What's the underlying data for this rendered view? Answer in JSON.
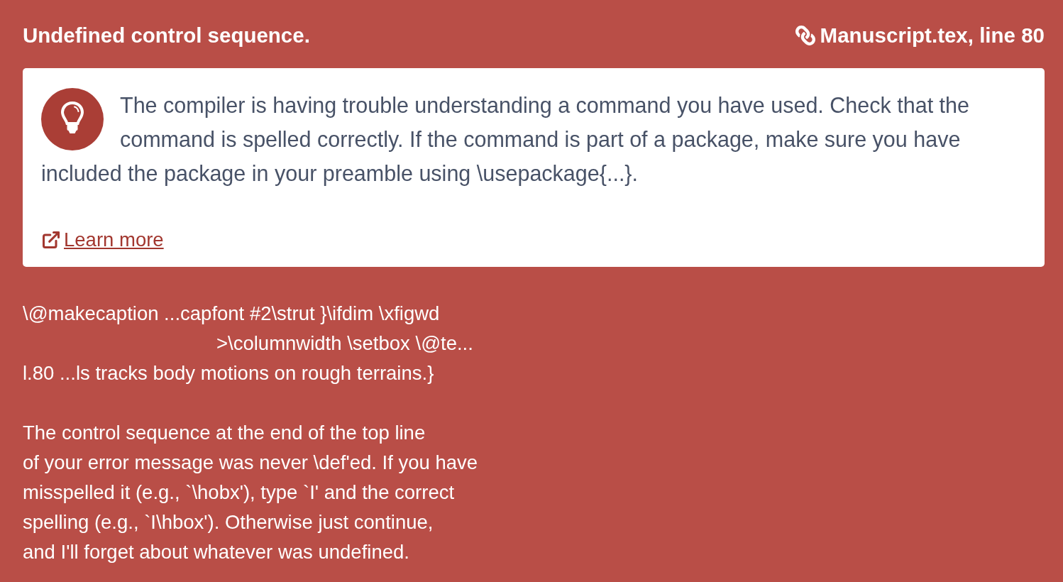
{
  "header": {
    "title": "Undefined control sequence.",
    "location": "Manuscript.tex, line 80"
  },
  "hint": {
    "text_parts": [
      "The compiler is having trouble understanding a command you have used. Check that the command is spelled correctly. If the command is part of a package, make sure you have",
      "included the package in your preamble using \\usepackage{...}."
    ],
    "learn_more": "Learn more"
  },
  "log": {
    "lines": [
      {
        "kind": "context",
        "text": "\\@makecaption ...capfont #2\\strut }\\ifdim \\xfigwd"
      },
      {
        "kind": "continuation",
        "text": ">\\columnwidth \\setbox \\@te..."
      },
      {
        "kind": "context",
        "text": "l.80 ...ls tracks body motions on rough terrains.}"
      }
    ],
    "help": "The control sequence at the end of the top line\nof your error message was never \\def'ed. If you have\nmisspelled it (e.g., `\\hobx'), type `I' and the correct\nspelling (e.g., `I\\hbox'). Otherwise just continue,\nand I'll forget about whatever was undefined."
  }
}
